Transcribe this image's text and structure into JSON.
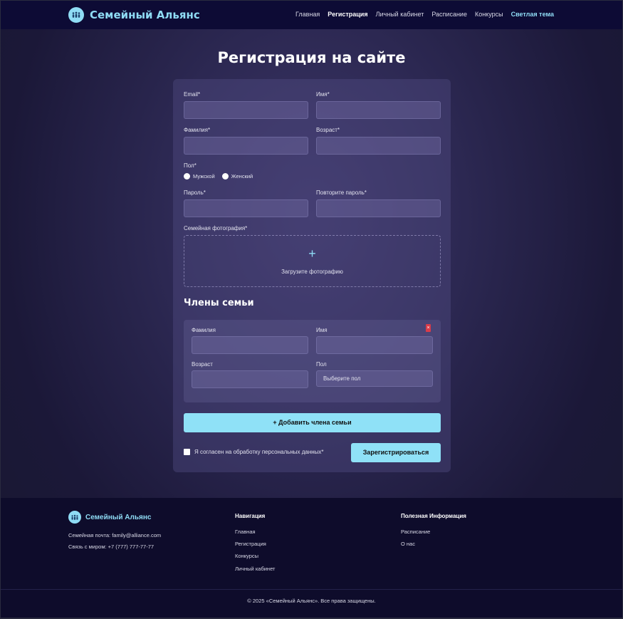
{
  "header": {
    "brand": "Семейный Альянс",
    "nav": [
      "Главная",
      "Регистрация",
      "Личный кабинет",
      "Расписание",
      "Конкурсы"
    ],
    "theme_toggle": "Светлая тема"
  },
  "main": {
    "title": "Регистрация на сайте",
    "fields": {
      "email": "Email*",
      "first_name": "Имя*",
      "last_name": "Фамилия*",
      "age": "Возраст*",
      "gender": "Пол*",
      "gender_male": "Мужской",
      "gender_female": "Женский",
      "password": "Пароль*",
      "password_repeat": "Повторите пароль*",
      "photo": "Семейная фотография*",
      "photo_upload": "Загрузите фотографию"
    },
    "members_title": "Члены семьи",
    "member": {
      "last_name": "Фамилия",
      "first_name": "Имя",
      "age": "Возраст",
      "gender": "Пол",
      "gender_placeholder": "Выберите пол",
      "remove": "×"
    },
    "add_member": "+ Добавить члена семьи",
    "consent": "Я согласен на обработку персональных данных*",
    "submit": "Зарегистрироваться"
  },
  "footer": {
    "brand": "Семейный Альянс",
    "email": "Семейная почта: family@alliance.com",
    "phone": "Связь с миром: +7 (777) 777-77-77",
    "nav_title": "Навигация",
    "nav": [
      "Главная",
      "Регистрация",
      "Конкурсы",
      "Личный кабинет"
    ],
    "info_title": "Полезная Информация",
    "info": [
      "Расписание",
      "О нас"
    ],
    "copyright": "© 2025 «Семейный Альянс». Все права защищены."
  },
  "colors": {
    "accent": "#8fdcf5",
    "header_bg": "#0d0b35",
    "footer_bg": "#0e0c2b",
    "danger": "#d93c4a"
  }
}
